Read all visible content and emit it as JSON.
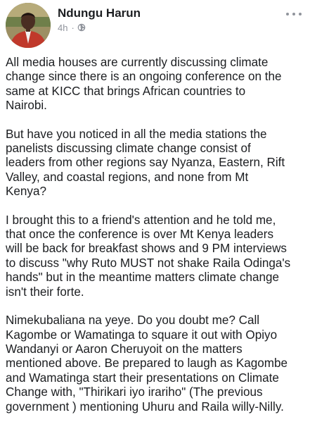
{
  "post": {
    "author": "Ndungu Harun",
    "timestamp": "4h",
    "separator": "·",
    "privacy_icon": "globe-icon",
    "more_icon": "more-options-icon",
    "paragraphs": [
      {
        "lines": [
          "All media houses are currently discussing climate",
          "change since there is an ongoing conference on the",
          "same at KICC that brings African countries to",
          "Nairobi."
        ]
      },
      {
        "lines": [
          "But have you noticed in all the media stations the",
          "panelists discussing climate change consist of",
          "leaders from other regions say Nyanza, Eastern, Rift",
          "Valley, and coastal regions, and none from Mt",
          "Kenya?"
        ]
      },
      {
        "lines": [
          "I brought this to a friend's attention and he told me,",
          "that once the conference is over Mt Kenya leaders",
          "will be back for breakfast shows and 9 PM interviews",
          "to discuss \"why Ruto MUST not shake Raila Odinga's",
          "hands\" but in the meantime matters climate change",
          "isn't their forte."
        ]
      },
      {
        "lines": [
          "Nimekubaliana na yeye. Do you doubt me? Call",
          "Kagombe or Wamatinga to square it out with Opiyo",
          "Wandanyi or Aaron Cheruyoit on the matters",
          "mentioned above. Be prepared to laugh as Kagombe",
          "and Wamatinga start their presentations on Climate",
          "Change with, \"Thirikari iyo irariho\" (The previous",
          "government ) mentioning Uhuru and Raila willy-Nilly."
        ]
      }
    ]
  }
}
